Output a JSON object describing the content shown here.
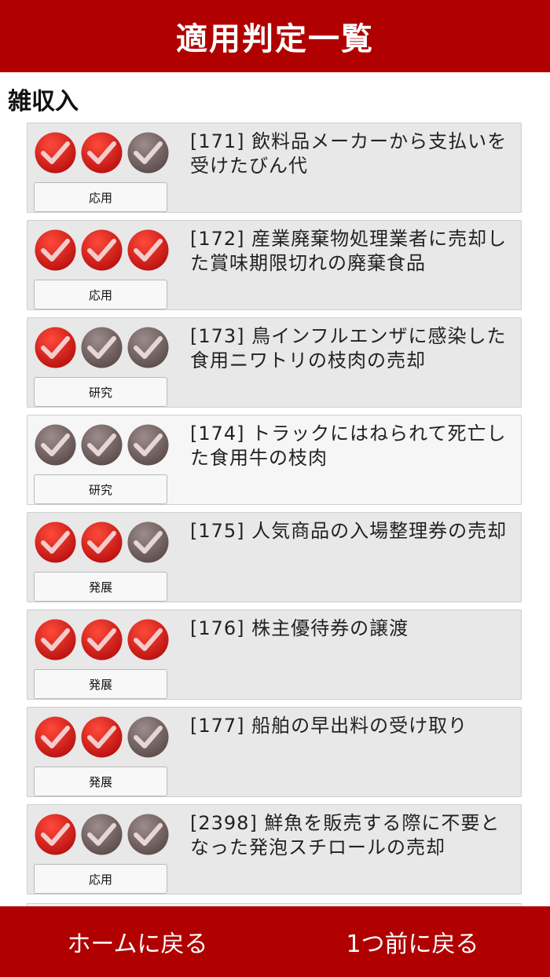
{
  "header": {
    "title": "適用判定一覧"
  },
  "section": {
    "title": "雑収入"
  },
  "colors": {
    "brand": "#b00000",
    "check_on": "#e02020",
    "check_off": "#7a6a6a"
  },
  "items": [
    {
      "title": "[171] 飲料品メーカーから支払いを受けたびん代",
      "level": "応用",
      "checks": [
        1,
        1,
        0
      ],
      "shade": "shaded"
    },
    {
      "title": "[172] 産業廃棄物処理業者に売却した賞味期限切れの廃棄食品",
      "level": "応用",
      "checks": [
        1,
        1,
        1
      ],
      "shade": "shaded"
    },
    {
      "title": "[173] 鳥インフルエンザに感染した食用ニワトリの枝肉の売却",
      "level": "研究",
      "checks": [
        1,
        0,
        0
      ],
      "shade": "shaded"
    },
    {
      "title": "[174] トラックにはねられて死亡した食用牛の枝肉",
      "level": "研究",
      "checks": [
        0,
        0,
        0
      ],
      "shade": "light"
    },
    {
      "title": "[175] 人気商品の入場整理券の売却",
      "level": "発展",
      "checks": [
        1,
        1,
        0
      ],
      "shade": "shaded"
    },
    {
      "title": "[176] 株主優待券の譲渡",
      "level": "発展",
      "checks": [
        1,
        1,
        1
      ],
      "shade": "shaded"
    },
    {
      "title": "[177] 船舶の早出料の受け取り",
      "level": "発展",
      "checks": [
        1,
        1,
        0
      ],
      "shade": "shaded"
    },
    {
      "title": "[2398] 鮮魚を販売する際に不要となった発泡スチロールの売却",
      "level": "応用",
      "checks": [
        1,
        0,
        0
      ],
      "shade": "shaded"
    }
  ],
  "icons": {
    "check": "check-circle-icon"
  },
  "footer": {
    "home_label": "ホームに戻る",
    "back_label": "1つ前に戻る"
  }
}
